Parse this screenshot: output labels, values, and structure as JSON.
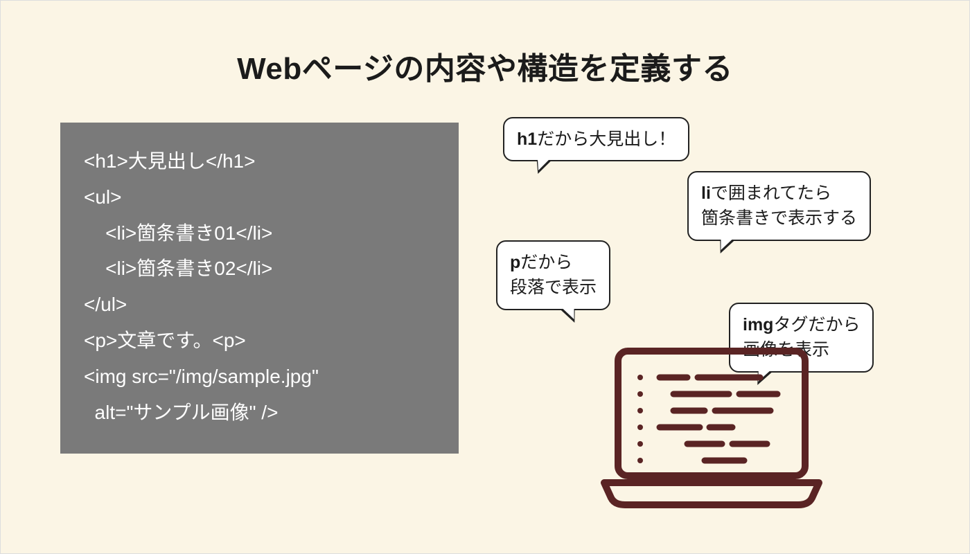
{
  "title": "Webページの内容や構造を定義する",
  "code": {
    "l1": "<h1>大見出し</h1>",
    "l2": "<ul>",
    "l3": "    <li>箇条書き01</li>",
    "l4": "    <li>箇条書き02</li>",
    "l5": "</ul>",
    "l6": "<p>文章です。<p>",
    "l7": "<img src=\"/img/sample.jpg\"",
    "l8": "  alt=\"サンプル画像\" />"
  },
  "bubbles": {
    "b1_bold": "h1",
    "b1_rest": "だから大見出し！",
    "b2_bold": "li",
    "b2_rest1": "で囲まれてたら",
    "b2_rest2": "箇条書きで表示する",
    "b3_bold": "p",
    "b3_rest1": "だから",
    "b3_rest2": "段落で表示",
    "b4_bold": "img",
    "b4_rest1": "タグだから",
    "b4_rest2": "画像を表示"
  },
  "colors": {
    "bg": "#fbf5e5",
    "codebg": "#7a7a7a",
    "laptop": "#5a2424"
  }
}
